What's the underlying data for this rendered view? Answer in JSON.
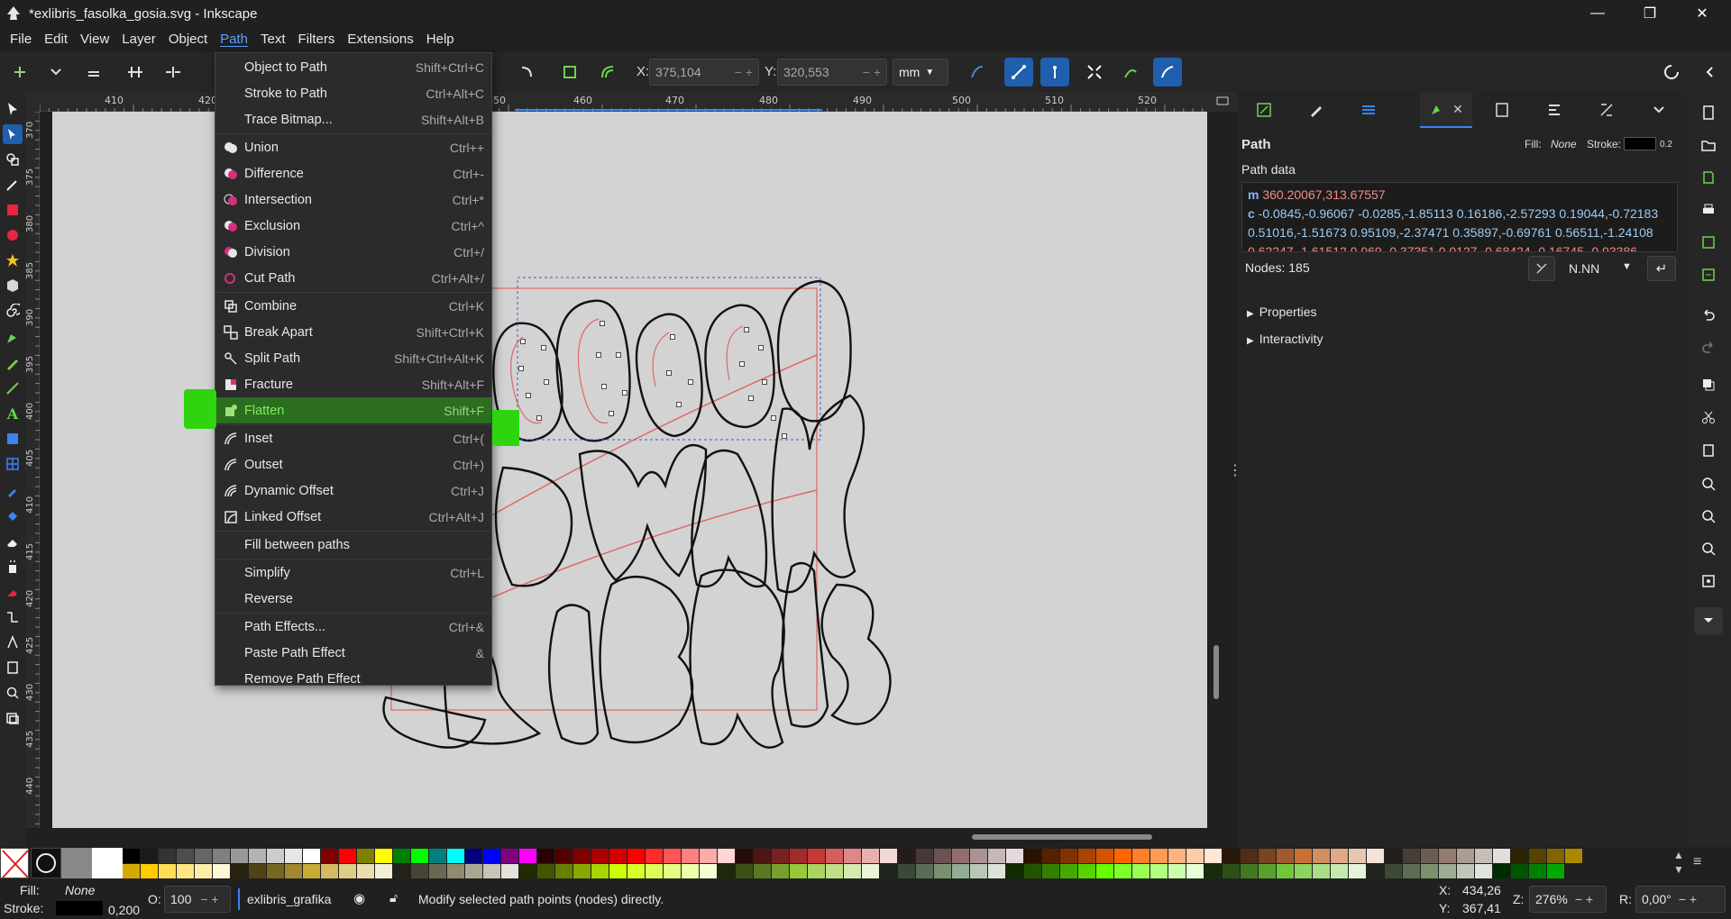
{
  "window": {
    "title": "*exlibris_fasolka_gosia.svg - Inkscape",
    "minimize_glyph": "—",
    "maximize_glyph": "❐",
    "close_glyph": "✕"
  },
  "menubar": [
    "File",
    "Edit",
    "View",
    "Layer",
    "Object",
    "Path",
    "Text",
    "Filters",
    "Extensions",
    "Help"
  ],
  "tool_controls": {
    "x_label": "X:",
    "x_value": "375,104",
    "y_label": "Y:",
    "y_value": "320,553",
    "unit": "mm"
  },
  "ruler": {
    "h_ticks": [
      "410",
      "420",
      "450",
      "460",
      "470",
      "480",
      "490",
      "500",
      "510",
      "520"
    ],
    "v_ticks": [
      "370",
      "375",
      "380",
      "385",
      "390",
      "395",
      "400",
      "405",
      "410",
      "415",
      "420",
      "425",
      "430",
      "435",
      "440"
    ]
  },
  "path_menu": [
    {
      "label": "Object to Path",
      "shortcut": "Shift+Ctrl+C",
      "icon": "none"
    },
    {
      "label": "Stroke to Path",
      "shortcut": "Ctrl+Alt+C",
      "icon": "none"
    },
    {
      "label": "Trace Bitmap...",
      "shortcut": "Shift+Alt+B",
      "icon": "none"
    },
    {
      "label": "Union",
      "shortcut": "Ctrl++",
      "icon": "union-icon"
    },
    {
      "label": "Difference",
      "shortcut": "Ctrl+-",
      "icon": "difference-icon"
    },
    {
      "label": "Intersection",
      "shortcut": "Ctrl+*",
      "icon": "intersection-icon"
    },
    {
      "label": "Exclusion",
      "shortcut": "Ctrl+^",
      "icon": "exclusion-icon"
    },
    {
      "label": "Division",
      "shortcut": "Ctrl+/",
      "icon": "division-icon"
    },
    {
      "label": "Cut Path",
      "shortcut": "Ctrl+Alt+/",
      "icon": "cut-path-icon"
    },
    {
      "label": "Combine",
      "shortcut": "Ctrl+K",
      "icon": "combine-icon"
    },
    {
      "label": "Break Apart",
      "shortcut": "Shift+Ctrl+K",
      "icon": "break-apart-icon"
    },
    {
      "label": "Split Path",
      "shortcut": "Shift+Ctrl+Alt+K",
      "icon": "split-path-icon"
    },
    {
      "label": "Fracture",
      "shortcut": "Shift+Alt+F",
      "icon": "fracture-icon"
    },
    {
      "label": "Flatten",
      "shortcut": "Shift+F",
      "icon": "flatten-icon"
    },
    {
      "label": "Inset",
      "shortcut": "Ctrl+(",
      "icon": "inset-icon"
    },
    {
      "label": "Outset",
      "shortcut": "Ctrl+)",
      "icon": "outset-icon"
    },
    {
      "label": "Dynamic Offset",
      "shortcut": "Ctrl+J",
      "icon": "dynamic-offset-icon"
    },
    {
      "label": "Linked Offset",
      "shortcut": "Ctrl+Alt+J",
      "icon": "linked-offset-icon"
    },
    {
      "label": "Fill between paths",
      "shortcut": "",
      "icon": "none"
    },
    {
      "label": "Simplify",
      "shortcut": "Ctrl+L",
      "icon": "none"
    },
    {
      "label": "Reverse",
      "shortcut": "",
      "icon": "none"
    },
    {
      "label": "Path Effects...",
      "shortcut": "Ctrl+&",
      "icon": "none"
    },
    {
      "label": "Paste Path Effect",
      "shortcut": "&",
      "icon": "none"
    },
    {
      "label": "Remove Path Effect",
      "shortcut": "",
      "icon": "none"
    }
  ],
  "dock": {
    "panel_title": "Path",
    "fill_label": "Fill:",
    "fill_value": "None",
    "stroke_label": "Stroke:",
    "stroke_width": "0.2",
    "path_data_label": "Path data",
    "path_data_lines": [
      {
        "cmd": "m",
        "text": "360.20067,313.67557"
      },
      {
        "cmd": "c",
        "text": "-0.0845,-0.96067 -0.0285,-1.85113 0.16186,-2.57293 0.19044,-0.72183"
      },
      {
        "cmd": "",
        "text": "0.51016,-1.51673 0.95109,-2.37471 0.35897,-0.69761 0.56511,-1.24108"
      },
      {
        "cmd": "",
        "text": "0.62247,-1.61512 0.069,-0.37351 0.0127,-0.68424 -0.16745,-0.93386"
      }
    ],
    "nodes_label": "Nodes: 185",
    "precision_label": "N.NN",
    "sections": [
      "Properties",
      "Interactivity"
    ]
  },
  "status": {
    "fill_label": "Fill:",
    "fill_value": "None",
    "stroke_label": "Stroke:",
    "stroke_width": "0,200",
    "opacity_label": "O:",
    "opacity_value": "100",
    "layer_name": "exlibris_grafika",
    "message": "Modify selected path points (nodes) directly.",
    "cursor_x_label": "X:",
    "cursor_x": "434,26",
    "cursor_y_label": "Y:",
    "cursor_y": "367,41",
    "zoom_label": "Z:",
    "zoom_value": "276%",
    "rotation_label": "R:",
    "rotation_value": "0,00°"
  },
  "palette_colors": [
    "#000000",
    "#1a1a1a",
    "#333333",
    "#4d4d4d",
    "#666666",
    "#808080",
    "#999999",
    "#b3b3b3",
    "#cccccc",
    "#e6e6e6",
    "#ffffff",
    "#800000",
    "#ff0000",
    "#808000",
    "#ffff00",
    "#008000",
    "#00ff00",
    "#008080",
    "#00ffff",
    "#000080",
    "#0000ff",
    "#800080",
    "#ff00ff",
    "#2b0000",
    "#550000",
    "#800000",
    "#aa0000",
    "#d40000",
    "#ff0000",
    "#ff2a2a",
    "#ff5555",
    "#ff8080",
    "#ffaaaa",
    "#ffd5d5",
    "#280b0b",
    "#501616",
    "#782121",
    "#a02c2c",
    "#c83737",
    "#d35f5f",
    "#de8787",
    "#e9afaf",
    "#f4d7d7",
    "#241c1c",
    "#483737",
    "#6c5353",
    "#916f6f",
    "#ac9393",
    "#c8b7b7",
    "#e3dbdb",
    "#2b1100",
    "#552200",
    "#803300",
    "#aa4400",
    "#d45500",
    "#ff6600",
    "#ff7f2a",
    "#ff9955",
    "#ffb380",
    "#ffccaa",
    "#ffe6d5",
    "#28170b",
    "#502d16",
    "#784421",
    "#a05a2c",
    "#c87137",
    "#d38d5f",
    "#deaa87",
    "#e9c6af",
    "#f4e3d7",
    "#241f1c",
    "#483e37",
    "#6c5d53",
    "#917c6f",
    "#ac9d93",
    "#c8beb7",
    "#e3dedb",
    "#2b2200",
    "#554400",
    "#806600",
    "#aa8800"
  ],
  "palette_row2": [
    "#d4aa00",
    "#ffcc00",
    "#ffdd55",
    "#ffe680",
    "#ffeeaa",
    "#fff6d5",
    "#28220b",
    "#504416",
    "#786721",
    "#a0892c",
    "#c8ab37",
    "#d3bc5f",
    "#decd87",
    "#e9ddaf",
    "#f4eed7",
    "#24221c",
    "#484537",
    "#6c6753",
    "#918a6f",
    "#aca793",
    "#c8c4b7",
    "#e3e2db",
    "#222b00",
    "#445500",
    "#668000",
    "#88aa00",
    "#aad400",
    "#ccff00",
    "#d4ff2a",
    "#ddff55",
    "#e5ff80",
    "#eeffaa",
    "#f6ffd5",
    "#1e280b",
    "#3c5016",
    "#5a7821",
    "#78a02c",
    "#96c837",
    "#abd35f",
    "#c0de87",
    "#d5e9af",
    "#eaf4d7",
    "#1e241c",
    "#3c4837",
    "#5a6c53",
    "#78916f",
    "#93ac93",
    "#b7c8b7",
    "#dbe3db",
    "#112b00",
    "#225500",
    "#338000",
    "#44aa00",
    "#55d400",
    "#66ff00",
    "#7fff2a",
    "#99ff55",
    "#b3ff80",
    "#ccffaa",
    "#e6ffd5",
    "#162d0b",
    "#2c5016",
    "#447821",
    "#5aa02c",
    "#71c837",
    "#8dd35f",
    "#aade87",
    "#c6e9af",
    "#e3f4d7",
    "#1f241c",
    "#3e4837",
    "#5d6c53",
    "#7c916f",
    "#9dac93",
    "#bec8b7",
    "#dee3db",
    "#002b00",
    "#005500",
    "#008000",
    "#00aa00"
  ]
}
